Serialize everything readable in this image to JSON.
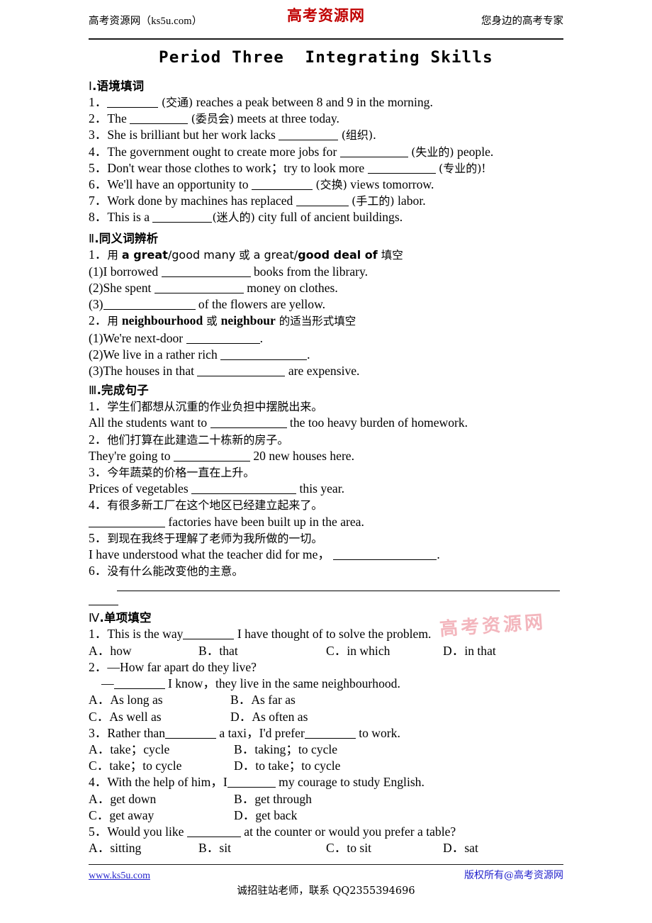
{
  "header": {
    "left": "高考资源网（ks5u.com）",
    "logo": "高考资源网",
    "right": "您身边的高考专家"
  },
  "title": "Period Three  Integrating Skills",
  "watermark": "高考资源网",
  "sections": {
    "s1": {
      "numeral": "Ⅰ",
      "heading": ".语境填词",
      "items": [
        {
          "num": "1．",
          "pre": "",
          "hint": "(交通)",
          "post": " reaches a peak between 8 and 9 in the morning.",
          "blank_w": 72
        },
        {
          "num": "2．",
          "pre": "The ",
          "hint": "(委员会)",
          "post": " meets at three today.",
          "blank_w": 82
        },
        {
          "num": "3．",
          "pre": "She is brilliant but her work lacks ",
          "hint": "(组织)",
          "post": ".",
          "blank_w": 84
        },
        {
          "num": "4．",
          "pre": "The government ought to create more jobs for ",
          "hint": "(失业的)",
          "post": " people.",
          "blank_w": 96
        },
        {
          "num": "5．",
          "pre": "Don't wear those clothes to work；try to look more ",
          "hint": "(专业的)",
          "post": "!",
          "blank_w": 96
        },
        {
          "num": "6．",
          "pre": "We'll have an opportunity to ",
          "hint": "(交换)",
          "post": " views tomorrow.",
          "blank_w": 86
        },
        {
          "num": "7．",
          "pre": "Work done by machines has replaced ",
          "hint": "(手工的)",
          "post": " labor.",
          "blank_w": 74
        },
        {
          "num": "8．",
          "pre": "This is a ",
          "hint": "(迷人的)",
          "post": " city full of ancient buildings.",
          "blank_w": 84
        }
      ]
    },
    "s2": {
      "numeral": "Ⅱ",
      "heading": ".同义词辨析",
      "q1": {
        "num": "1．",
        "prompt_cn1": "用 ",
        "prompt_b1": "a great",
        "prompt_r1": "/good many",
        "prompt_cn2": " 或 ",
        "prompt_r2": "a great/",
        "prompt_b2": "good deal of",
        "prompt_cn3": " 填空",
        "subs": [
          {
            "label": "(1)",
            "pre": "I borrowed ",
            "post": " books from the library.",
            "blank_w": 126
          },
          {
            "label": "(2)",
            "pre": "She spent ",
            "post": " money on clothes.",
            "blank_w": 126
          },
          {
            "label": "(3)",
            "pre": "",
            "post": " of the flowers are yellow.",
            "blank_w": 130
          }
        ]
      },
      "q2": {
        "num": "2．",
        "prompt_cn1": "用 ",
        "prompt_b1": "neighbourhood",
        "prompt_cn2": " 或 ",
        "prompt_b2": "neighbour",
        "prompt_cn3": " 的适当形式填空",
        "subs": [
          {
            "label": "(1)",
            "pre": "We're next-door ",
            "post": ".",
            "blank_w": 104
          },
          {
            "label": "(2)",
            "pre": "We live in a rather rich ",
            "post": ".",
            "blank_w": 122
          },
          {
            "label": "(3)",
            "pre": "The houses in that ",
            "post": " are expensive.",
            "blank_w": 124
          }
        ]
      }
    },
    "s3": {
      "numeral": "Ⅲ",
      "heading": ".完成句子",
      "items": [
        {
          "num": "1．",
          "cn": "学生们都想从沉重的作业负担中摆脱出来。",
          "pre": "All the students want to ",
          "post": " the too heavy burden of homework.",
          "blank_w": 108
        },
        {
          "num": "2．",
          "cn": "他们打算在此建造二十栋新的房子。",
          "pre": "They're going to ",
          "post": " 20 new houses here.",
          "blank_w": 108
        },
        {
          "num": "3．",
          "cn": "今年蔬菜的价格一直在上升。",
          "pre": "Prices of vegetables ",
          "post": " this year.",
          "blank_w": 148
        },
        {
          "num": "4．",
          "cn": "有很多新工厂在这个地区已经建立起来了。",
          "pre": "",
          "post": " factories have been built up in the area.",
          "blank_w": 108
        },
        {
          "num": "5．",
          "cn": "到现在我终于理解了老师为我所做的一切。",
          "pre": "I have understood what the teacher did for me，",
          "post": ".",
          "blank_w": 146
        },
        {
          "num": "6．",
          "cn": "没有什么能改变他的主意。",
          "pre": "",
          "post": "",
          "blank_w": 0
        }
      ]
    },
    "s4": {
      "numeral": "Ⅳ",
      "heading": ".单项填空",
      "items": [
        {
          "num": "1．",
          "stem_pre": "This is the way",
          "stem_post": " I have thought of to solve the problem.",
          "blank_w": 72,
          "stem2": null,
          "layout": "four",
          "options": [
            {
              "key": "A．",
              "text": "how"
            },
            {
              "key": "B．",
              "text": "that"
            },
            {
              "key": "C．",
              "text": "in which"
            },
            {
              "key": "D．",
              "text": "in that"
            }
          ]
        },
        {
          "num": "2．",
          "stem_pre": "—How far apart do they live?",
          "stem_post": "",
          "blank_w": 0,
          "stem2_pre": "—",
          "stem2_post": " I know，they live in the same neighbourhood.",
          "stem2_blank_w": 72,
          "layout": "two",
          "options": [
            {
              "key": "A．",
              "text": "As long as"
            },
            {
              "key": "B．",
              "text": "As far as"
            },
            {
              "key": "C．",
              "text": "As well as"
            },
            {
              "key": "D．",
              "text": "As often as"
            }
          ]
        },
        {
          "num": "3．",
          "stem_pre": "Rather than",
          "stem_mid": " a taxi，I'd prefer",
          "stem_post": " to work.",
          "blank_w": 72,
          "blank2_w": 72,
          "layout": "two",
          "options": [
            {
              "key": "A．",
              "text": "take；cycle"
            },
            {
              "key": "B．",
              "text": "taking；to cycle"
            },
            {
              "key": "C．",
              "text": "take；to cycle"
            },
            {
              "key": "D．",
              "text": "to take；to cycle"
            }
          ]
        },
        {
          "num": "4．",
          "stem_pre": "With the help of him，I",
          "stem_post": " my courage to study English.",
          "blank_w": 68,
          "layout": "two",
          "options": [
            {
              "key": "A．",
              "text": "get down"
            },
            {
              "key": "B．",
              "text": "get through"
            },
            {
              "key": "C．",
              "text": "get away"
            },
            {
              "key": "D．",
              "text": "get back"
            }
          ]
        },
        {
          "num": "5．",
          "stem_pre": "Would you like ",
          "stem_post": " at the counter or would you prefer a table?",
          "blank_w": 76,
          "layout": "four",
          "options": [
            {
              "key": "A．",
              "text": "sitting"
            },
            {
              "key": "B．",
              "text": "sit"
            },
            {
              "key": "C．",
              "text": "to sit"
            },
            {
              "key": "D．",
              "text": "sat"
            }
          ]
        }
      ]
    }
  },
  "footer": {
    "left": "www.ks5u.com",
    "right": "版权所有@高考资源网",
    "center": "诚招驻站老师，联系 QQ2355394696"
  }
}
